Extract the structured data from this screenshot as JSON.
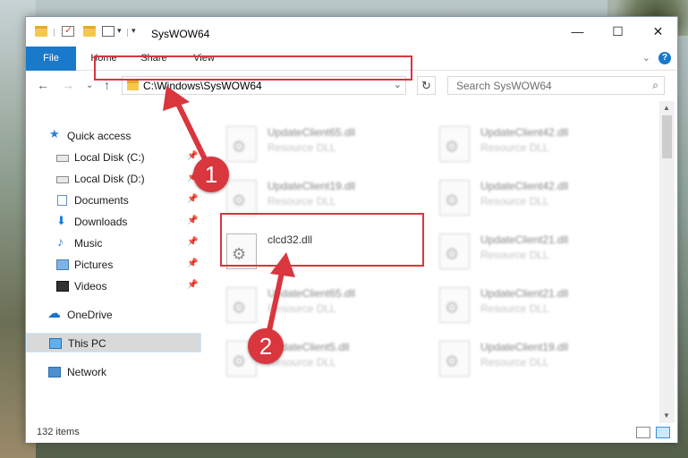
{
  "window": {
    "title": "SysWOW64",
    "minimize": "—",
    "maximize": "☐",
    "close": "✕"
  },
  "ribbon": {
    "tabs": [
      "File",
      "Home",
      "Share",
      "View"
    ]
  },
  "address": {
    "path": "C:\\Windows\\SysWOW64",
    "search_placeholder": "Search SysWOW64"
  },
  "sidebar": {
    "items": [
      {
        "label": "Quick access",
        "icon": "star-icon"
      },
      {
        "label": "Local Disk (C:)",
        "icon": "drive-icon",
        "pinned": true
      },
      {
        "label": "Local Disk (D:)",
        "icon": "drive-icon",
        "pinned": true
      },
      {
        "label": "Documents",
        "icon": "documents-icon",
        "pinned": true
      },
      {
        "label": "Downloads",
        "icon": "downloads-icon",
        "pinned": true
      },
      {
        "label": "Music",
        "icon": "music-icon",
        "pinned": true
      },
      {
        "label": "Pictures",
        "icon": "pictures-icon",
        "pinned": true
      },
      {
        "label": "Videos",
        "icon": "videos-icon",
        "pinned": true
      },
      {
        "label": "OneDrive",
        "icon": "onedrive-icon"
      },
      {
        "label": "This PC",
        "icon": "this-pc-icon",
        "selected": true
      },
      {
        "label": "Network",
        "icon": "network-icon"
      }
    ]
  },
  "files": {
    "left_column": [
      {
        "name": "UpdateClient65.dll",
        "type": "Resource DLL",
        "blurred": true
      },
      {
        "name": "UpdateClient19.dll",
        "type": "Resource DLL",
        "blurred": true
      },
      {
        "name": "clcd32.dll",
        "type": "",
        "blurred": false
      },
      {
        "name": "UpdateClient65.dll",
        "type": "Resource DLL",
        "blurred": true
      },
      {
        "name": "UpdateClient5.dll",
        "type": "Resource DLL",
        "blurred": true
      }
    ],
    "right_column": [
      {
        "name": "UpdateClient42.dll",
        "type": "Resource DLL",
        "blurred": true
      },
      {
        "name": "UpdateClient42.dll",
        "type": "Resource DLL",
        "blurred": true
      },
      {
        "name": "UpdateClient21.dll",
        "type": "Resource DLL",
        "blurred": true
      },
      {
        "name": "UpdateClient21.dll",
        "type": "Resource DLL",
        "blurred": true
      },
      {
        "name": "UpdateClient19.dll",
        "type": "Resource DLL",
        "blurred": true
      }
    ]
  },
  "status": {
    "item_count": "132 items"
  },
  "callouts": [
    "1",
    "2"
  ],
  "colors": {
    "accent": "#1979ca",
    "highlight": "#d9363e",
    "selected_nav": "#d9d9d9"
  }
}
